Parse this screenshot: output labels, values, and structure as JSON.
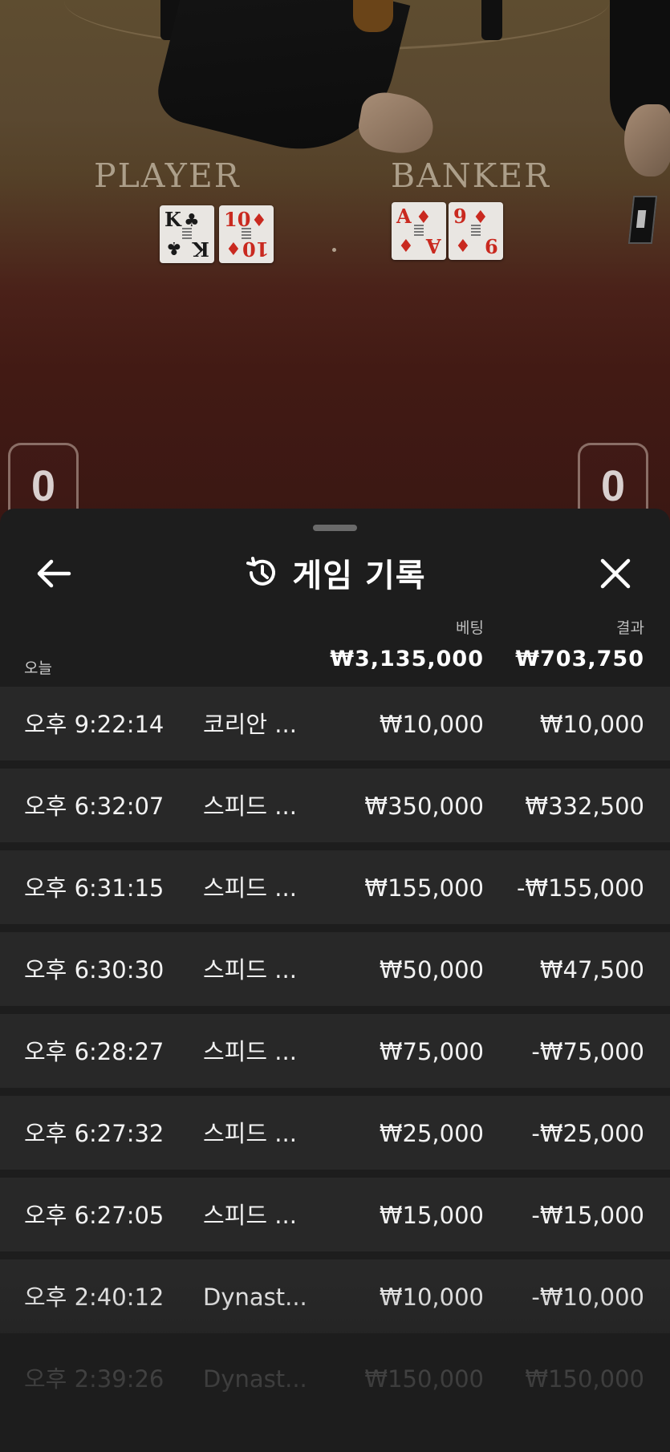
{
  "table": {
    "player_label": "PLAYER",
    "banker_label": "BANKER",
    "player_cards": [
      {
        "rank": "K",
        "suit": "♣",
        "color": "#1a1a1a"
      },
      {
        "rank": "10",
        "suit": "♦",
        "color": "#c9291f"
      }
    ],
    "banker_cards": [
      {
        "rank": "A",
        "suit": "♦",
        "color": "#c9291f"
      },
      {
        "rank": "9",
        "suit": "♦",
        "color": "#c9291f"
      }
    ],
    "player_score": "0",
    "banker_score": "0"
  },
  "header": {
    "title": "게임 기록",
    "back_icon": "arrow-left-icon",
    "history_icon": "history-icon",
    "close_icon": "close-icon"
  },
  "summary": {
    "bet_label": "베팅",
    "result_label": "결과",
    "period_label": "오늘",
    "total_bet": "₩3,135,000",
    "total_result": "₩703,750"
  },
  "rows": [
    {
      "time": "오후 9:22:14",
      "game": "코리안 ...",
      "bet": "₩10,000",
      "result": "₩10,000"
    },
    {
      "time": "오후 6:32:07",
      "game": "스피드 ...",
      "bet": "₩350,000",
      "result": "₩332,500"
    },
    {
      "time": "오후 6:31:15",
      "game": "스피드 ...",
      "bet": "₩155,000",
      "result": "-₩155,000"
    },
    {
      "time": "오후 6:30:30",
      "game": "스피드 ...",
      "bet": "₩50,000",
      "result": "₩47,500"
    },
    {
      "time": "오후 6:28:27",
      "game": "스피드 ...",
      "bet": "₩75,000",
      "result": "-₩75,000"
    },
    {
      "time": "오후 6:27:32",
      "game": "스피드 ...",
      "bet": "₩25,000",
      "result": "-₩25,000"
    },
    {
      "time": "오후 6:27:05",
      "game": "스피드 ...",
      "bet": "₩15,000",
      "result": "-₩15,000"
    },
    {
      "time": "오후 2:40:12",
      "game": "Dynast...",
      "bet": "₩10,000",
      "result": "-₩10,000"
    },
    {
      "time": "오후 2:39:26",
      "game": "Dynast...",
      "bet": "₩150,000",
      "result": "₩150,000"
    }
  ],
  "colors": {
    "sheet_background": "#1d1d1d",
    "row_background": "#282828",
    "text": "#f2f2f2",
    "muted_text": "#bdbdbd"
  }
}
